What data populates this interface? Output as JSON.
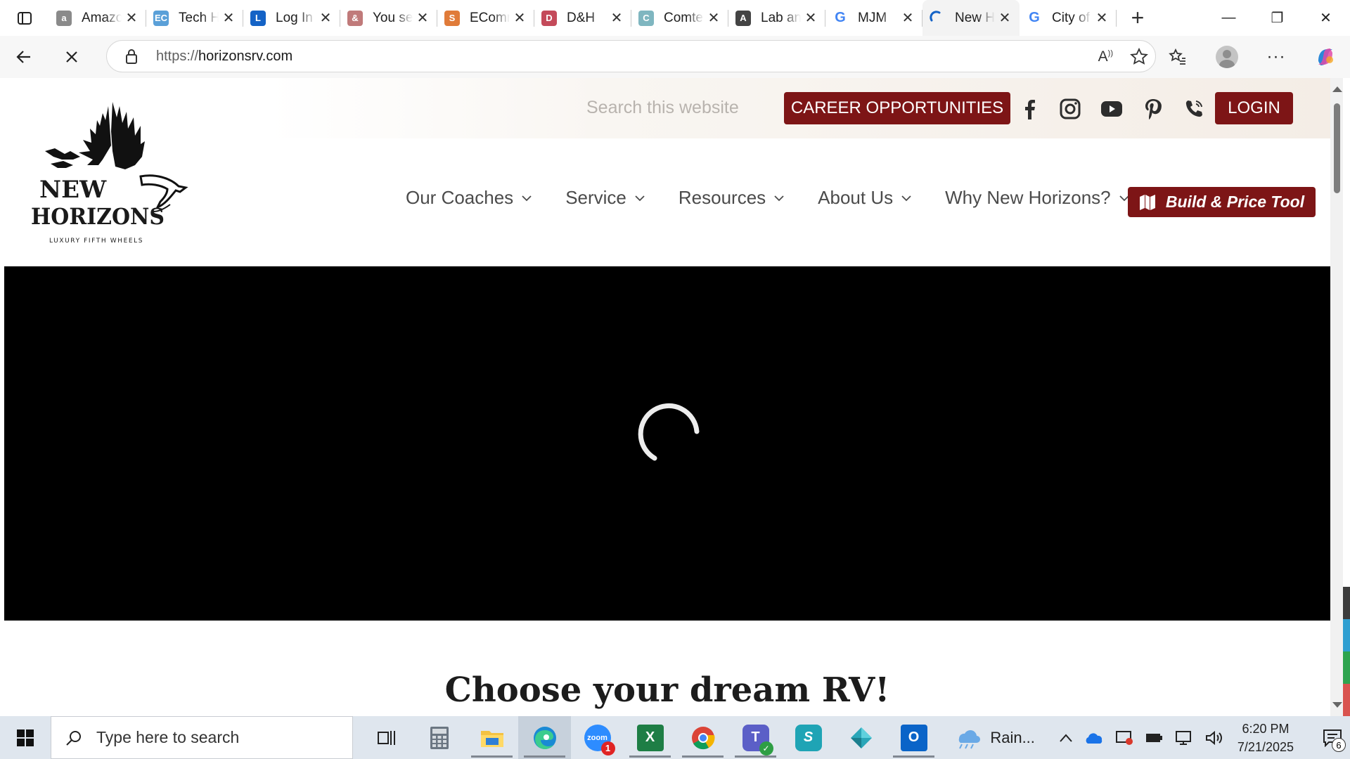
{
  "browser": {
    "tabs": [
      {
        "title": "Amazon",
        "icon": "amazon-icon",
        "color": "#8a8a8a",
        "glyph": "a"
      },
      {
        "title": "Tech Hub",
        "icon": "ec-icon",
        "color": "#5aa0d8",
        "glyph": "EC"
      },
      {
        "title": "Log In",
        "icon": "login-site-icon",
        "color": "#1463c6",
        "glyph": "L"
      },
      {
        "title": "You searched",
        "icon": "people-icon",
        "color": "#c07a7a",
        "glyph": "&"
      },
      {
        "title": "ECommerce",
        "icon": "ecommerce-icon",
        "color": "#e07b39",
        "glyph": "S"
      },
      {
        "title": "D&H",
        "icon": "dh-icon",
        "color": "#c44a5a",
        "glyph": "D"
      },
      {
        "title": "Comtech",
        "icon": "comtech-icon",
        "color": "#7fb6c0",
        "glyph": "C"
      },
      {
        "title": "Lab and",
        "icon": "lab-icon",
        "color": "#444444",
        "glyph": "A"
      },
      {
        "title": "MJM",
        "icon": "google-icon",
        "color": "#4285f4",
        "glyph": "G"
      },
      {
        "title": "New Horizons",
        "icon": "loading-icon",
        "color": "#1463c6",
        "glyph": "",
        "active": true
      },
      {
        "title": "City of",
        "icon": "google-icon",
        "color": "#4285f4",
        "glyph": "G"
      }
    ],
    "url_prefix": "https://",
    "url_host": "horizonsrv.com"
  },
  "page": {
    "search_placeholder": "Search this website",
    "career_label": "CAREER OPPORTUNITIES",
    "login_label": "LOGIN",
    "logo_line1": "NEW",
    "logo_line2": "HORIZONS",
    "logo_tagline": "LUXURY FIFTH WHEELS",
    "nav": [
      "Our Coaches",
      "Service",
      "Resources",
      "About Us",
      "Why New Horizons?"
    ],
    "build_label": "Build & Price Tool",
    "heading": "Choose your dream RV!",
    "brand_color": "#7d1516"
  },
  "taskbar": {
    "search_placeholder": "Type here to search",
    "weather": "Rain...",
    "time": "6:20 PM",
    "date": "7/21/2025",
    "notifications": "6",
    "zoom_badge": "1"
  }
}
